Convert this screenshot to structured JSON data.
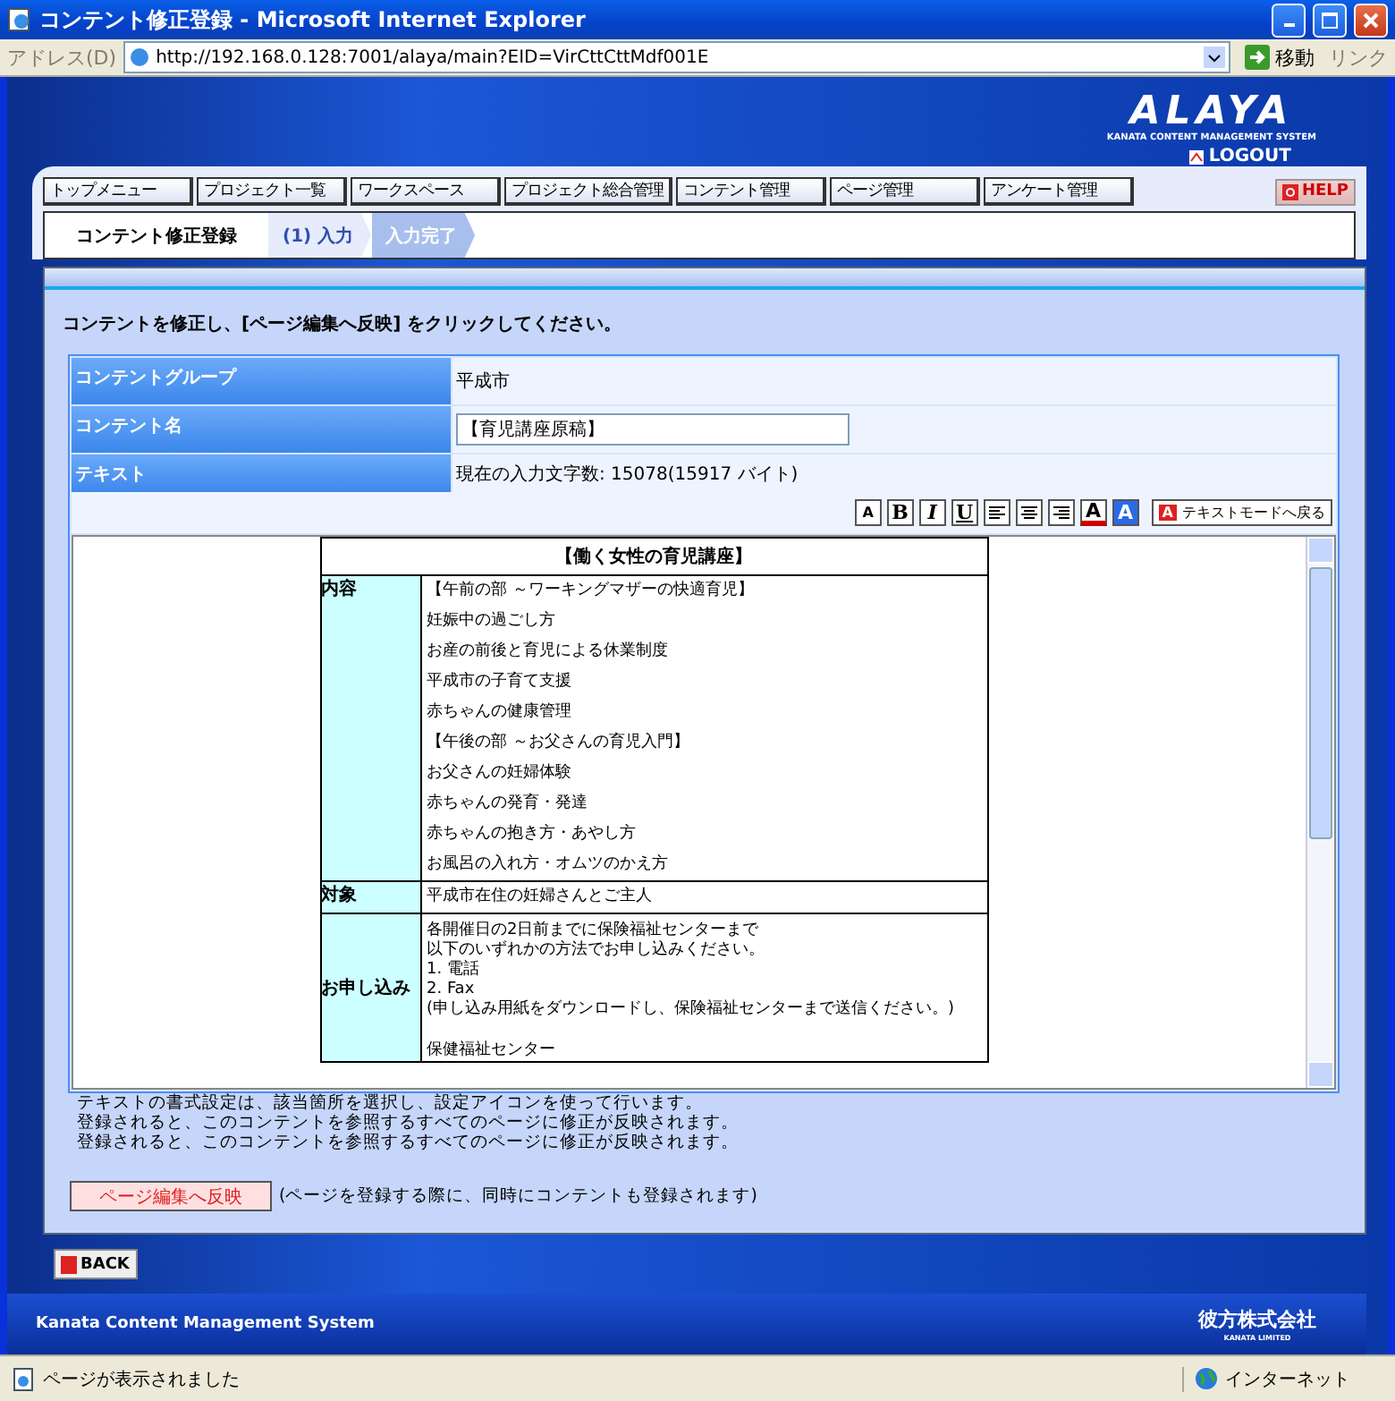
{
  "window": {
    "title": "コンテント修正登録 - Microsoft Internet Explorer"
  },
  "address_bar": {
    "label": "アドレス(D)",
    "url": "http://192.168.0.128:7001/alaya/main?EID=VirCttCttMdf001E",
    "go": "移動",
    "links": "リンク"
  },
  "header": {
    "logo": "ALAYA",
    "tagline": "KANATA CONTENT MANAGEMENT SYSTEM",
    "logout": "LOGOUT",
    "help": "HELP"
  },
  "nav": [
    "トップメニュー",
    "プロジェクト一覧",
    "ワークスペース",
    "プロジェクト総合管理",
    "コンテント管理",
    "ページ管理",
    "アンケート管理"
  ],
  "breadcrumb": {
    "page": "コンテント修正登録",
    "steps": [
      {
        "label": "(1) 入力",
        "selected": true
      },
      {
        "label": "入力完了",
        "selected": false
      }
    ]
  },
  "instruction": "コンテントを修正し、[ページ編集へ反映] をクリックしてください。",
  "form": [
    {
      "label": "コンテントグループ",
      "kind": "text",
      "value": "平成市"
    },
    {
      "label": "コンテント名",
      "kind": "input",
      "value": "【育児講座原稿】"
    },
    {
      "label": "テキスト",
      "kind": "text",
      "value": "現在の入力文字数: 15078(15917 バイト)"
    }
  ],
  "toolbar": [
    {
      "kind": "size",
      "label": "A"
    },
    {
      "kind": "bold",
      "label": "B"
    },
    {
      "kind": "italic",
      "label": "I"
    },
    {
      "kind": "underline",
      "label": "U"
    },
    {
      "kind": "align-left"
    },
    {
      "kind": "align-center"
    },
    {
      "kind": "align-right"
    },
    {
      "kind": "color",
      "label": "A"
    },
    {
      "kind": "highlight",
      "label": "A"
    },
    {
      "kind": "mode",
      "icon": "A",
      "label": "テキストモードへ戻る"
    }
  ],
  "editor": {
    "title": "【働く女性の育児講座】",
    "rows": [
      {
        "head": "内容",
        "lines": [
          "【午前の部 ～ワーキングマザーの快適育児】",
          "妊娠中の過ごし方",
          "お産の前後と育児による休業制度",
          "平成市の子育て支援",
          "赤ちゃんの健康管理",
          "【午後の部 ～お父さんの育児入門】",
          "お父さんの妊婦体験",
          "赤ちゃんの発育・発達",
          "赤ちゃんの抱き方・あやし方",
          "お風呂の入れ方・オムツのかえ方"
        ]
      },
      {
        "head": "対象",
        "lines": [
          "平成市在住の妊婦さんとご主人"
        ]
      },
      {
        "head": "お申し込み",
        "lines": [
          "各開催日の2日前までに保険福祉センターまで",
          "以下のいずれかの方法でお申し込みください。",
          "1. 電話",
          "2. Fax",
          "(申し込み用紙をダウンロードし、保険福祉センターまで送信ください。)",
          "保健福祉センター"
        ]
      }
    ]
  },
  "notes": [
    "テキストの書式設定は、該当箇所を選択し、設定アイコンを使って行います。",
    "登録されると、このコンテントを参照するすべてのページに修正が反映されます。",
    "登録されると、このコンテントを参照するすべてのページに修正が反映されます。"
  ],
  "submit": {
    "label": "ページ編集へ反映",
    "note": "(ページを登録する際に、同時にコンテントも登録されます)"
  },
  "back": "BACK",
  "footer": {
    "system": "Kanata Content Management System",
    "company": "彼方株式会社",
    "company_en": "KANATA LIMITED"
  },
  "status_bar": {
    "message": "ページが表示されました",
    "zone": "インターネット"
  }
}
